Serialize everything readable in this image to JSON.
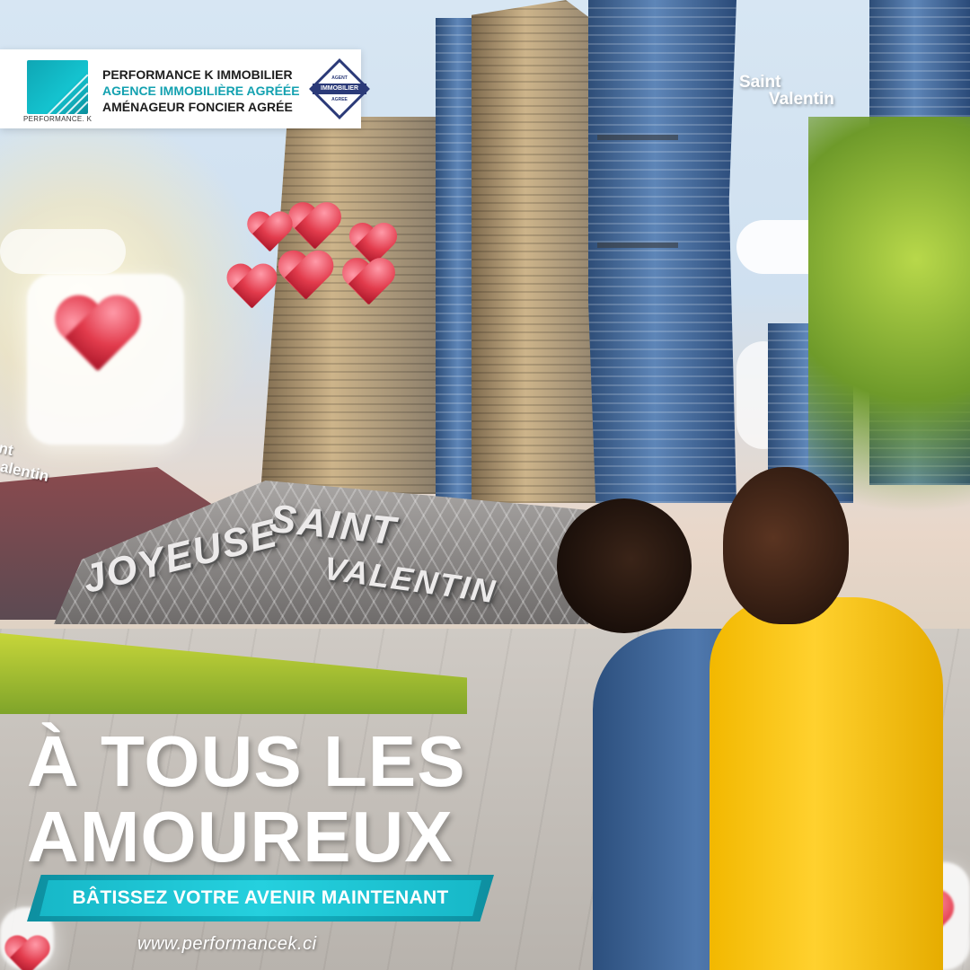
{
  "header": {
    "company_name": "PERFORMANCE K IMMOBILIER",
    "line2": "AGENCE IMMOBILIÈRE AGRÉÉE",
    "line3": "AMÉNAGEUR FONCIER AGRÉE",
    "logo_caption": "PERFORMANCE. K",
    "badge": {
      "top": "AGENT",
      "middle": "IMMOBILIER",
      "bottom": "AGREE"
    }
  },
  "corner_tag": {
    "line1": "Saint",
    "line2": "Valentin"
  },
  "building_sign": {
    "word1": "JOYEUSE",
    "word2": "SAINT",
    "word3": "VALENTIN"
  },
  "side_sign": {
    "line1": "nt",
    "line2": "alentin"
  },
  "headline": {
    "line1": "À TOUS LES",
    "line2": "AMOUREUX"
  },
  "ribbon_text": "BÂTISSEZ VOTRE AVENIR MAINTENANT",
  "website": "www.performancek.ci",
  "colors": {
    "brand_teal": "#13a1b0",
    "ribbon": "#17b8c8",
    "heart_red": "#e23b4c",
    "navy_badge": "#2b3a78"
  }
}
